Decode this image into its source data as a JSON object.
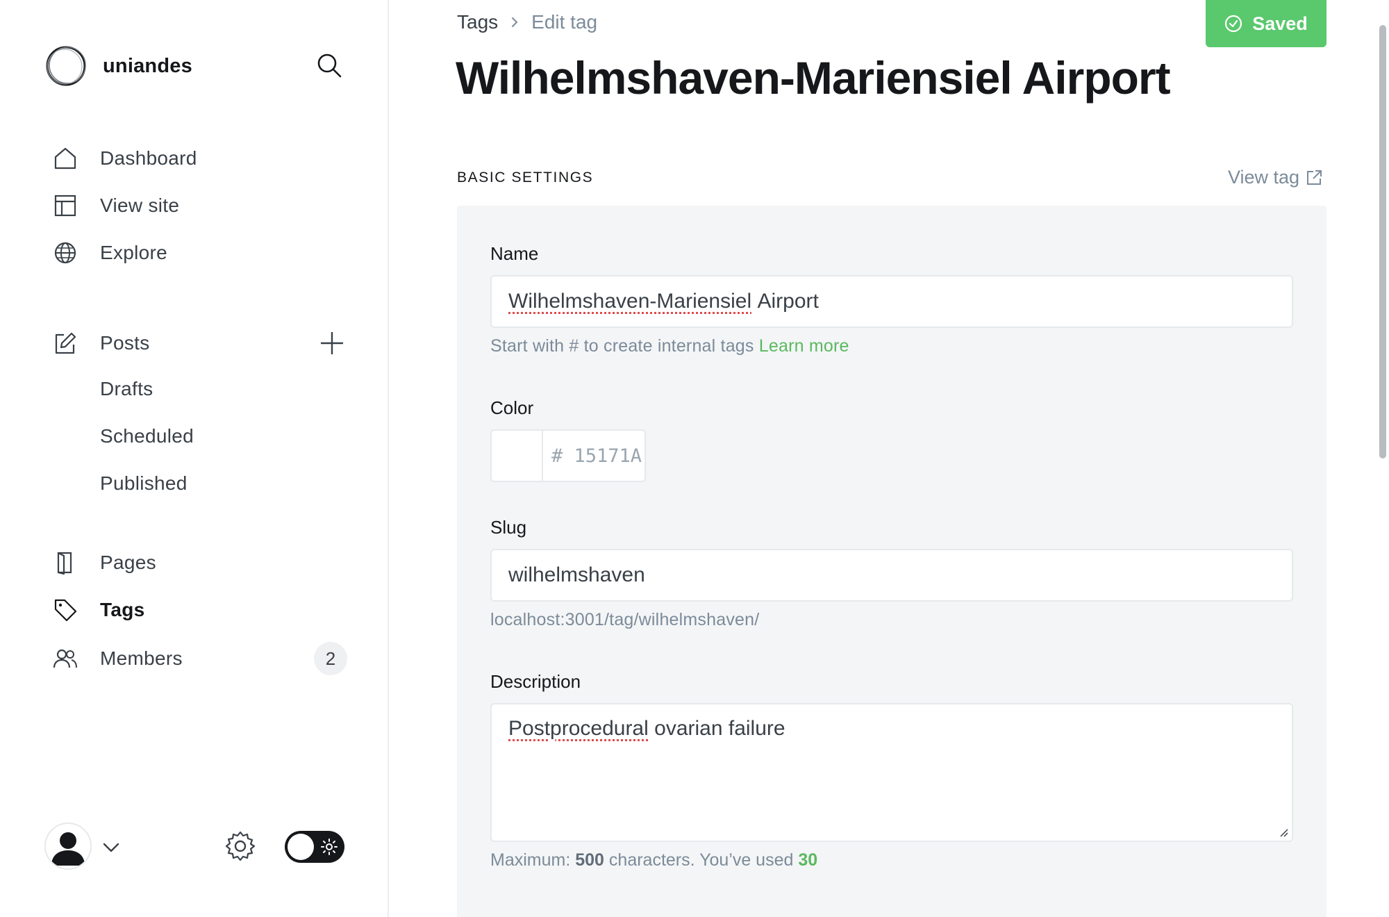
{
  "sidebar": {
    "brand_name": "uniandes",
    "nav": {
      "dashboard": "Dashboard",
      "view_site": "View site",
      "explore": "Explore",
      "posts": "Posts",
      "drafts": "Drafts",
      "scheduled": "Scheduled",
      "published": "Published",
      "pages": "Pages",
      "tags": "Tags",
      "members": "Members",
      "members_count": "2"
    },
    "active_item": "Tags"
  },
  "header": {
    "breadcrumb_parent": "Tags",
    "breadcrumb_current": "Edit tag",
    "saved_label": "Saved",
    "title": "Wilhelmshaven-Mariensiel Airport"
  },
  "form": {
    "section_title": "BASIC SETTINGS",
    "view_tag_label": "View tag",
    "name_label": "Name",
    "name_value_part1": "Wilhelmshaven-Mariensiel",
    "name_value_part2": "Airport",
    "name_hint": "Start with # to create internal tags",
    "learn_more": "Learn more",
    "color_label": "Color",
    "color_hash": "#",
    "color_placeholder": "15171A",
    "slug_label": "Slug",
    "slug_value": "wilhelmshaven",
    "slug_url": "localhost:3001/tag/wilhelmshaven/",
    "description_label": "Description",
    "description_value_part1": "Postprocedural",
    "description_value_part2": "ovarian failure",
    "counter_prefix": "Maximum:",
    "counter_max": "500",
    "counter_mid": "characters. You’ve used",
    "counter_used": "30"
  },
  "colors": {
    "accent_green": "#5ac86d",
    "text_dark": "#15171a",
    "text_muted": "#7c8b9a"
  }
}
